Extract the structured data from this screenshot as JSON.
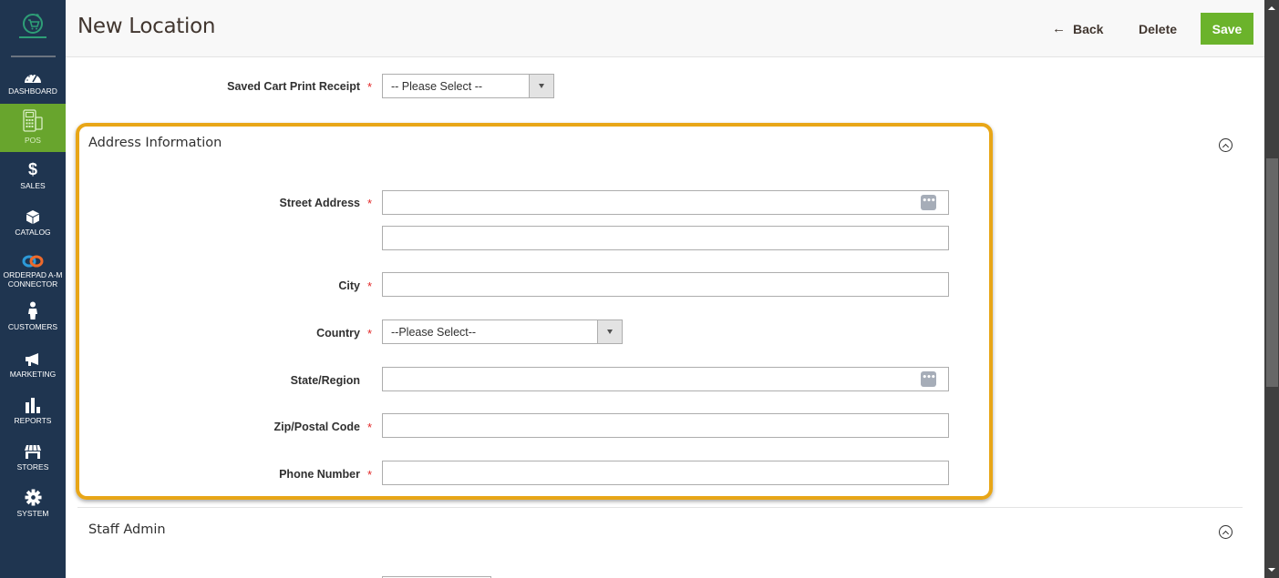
{
  "sidebar": {
    "logo": "shopping-cart-refresh-logo",
    "items": [
      {
        "label": "DASHBOARD",
        "icon": "speedometer-icon",
        "active": false
      },
      {
        "label": "POS",
        "icon": "pos-terminal-icon",
        "active": true
      },
      {
        "label": "SALES",
        "icon": "dollar-icon",
        "active": false
      },
      {
        "label": "CATALOG",
        "icon": "box-icon",
        "active": false
      },
      {
        "label": "ORDERPAD A-M CONNECTOR",
        "icon": "link-icon",
        "active": false
      },
      {
        "label": "CUSTOMERS",
        "icon": "person-icon",
        "active": false
      },
      {
        "label": "MARKETING",
        "icon": "megaphone-icon",
        "active": false
      },
      {
        "label": "REPORTS",
        "icon": "bar-chart-icon",
        "active": false
      },
      {
        "label": "STORES",
        "icon": "storefront-icon",
        "active": false
      },
      {
        "label": "SYSTEM",
        "icon": "gear-icon",
        "active": false
      }
    ]
  },
  "header": {
    "title": "New Location",
    "back_label": "Back",
    "delete_label": "Delete",
    "save_label": "Save"
  },
  "top_field": {
    "label": "Saved Cart Print Receipt",
    "required": true,
    "selected": "-- Please Select --"
  },
  "address_section": {
    "title": "Address Information",
    "fields": {
      "street": {
        "label": "Street Address",
        "required": true,
        "value_line1": "",
        "value_line2": ""
      },
      "city": {
        "label": "City",
        "required": true,
        "value": ""
      },
      "country": {
        "label": "Country",
        "required": true,
        "selected": "--Please Select--"
      },
      "state": {
        "label": "State/Region",
        "required": false,
        "value": ""
      },
      "zip": {
        "label": "Zip/Postal Code",
        "required": true,
        "value": ""
      },
      "phone": {
        "label": "Phone Number",
        "required": true,
        "value": ""
      }
    }
  },
  "staff_section": {
    "title": "Staff Admin"
  },
  "required_marker": "*",
  "dots_glyph": "•••",
  "colors": {
    "sidebar_bg": "#1f3550",
    "active_nav": "#68a52d",
    "save_button": "#6bb32b",
    "highlight_border": "#e8a617",
    "required": "#e22626"
  }
}
